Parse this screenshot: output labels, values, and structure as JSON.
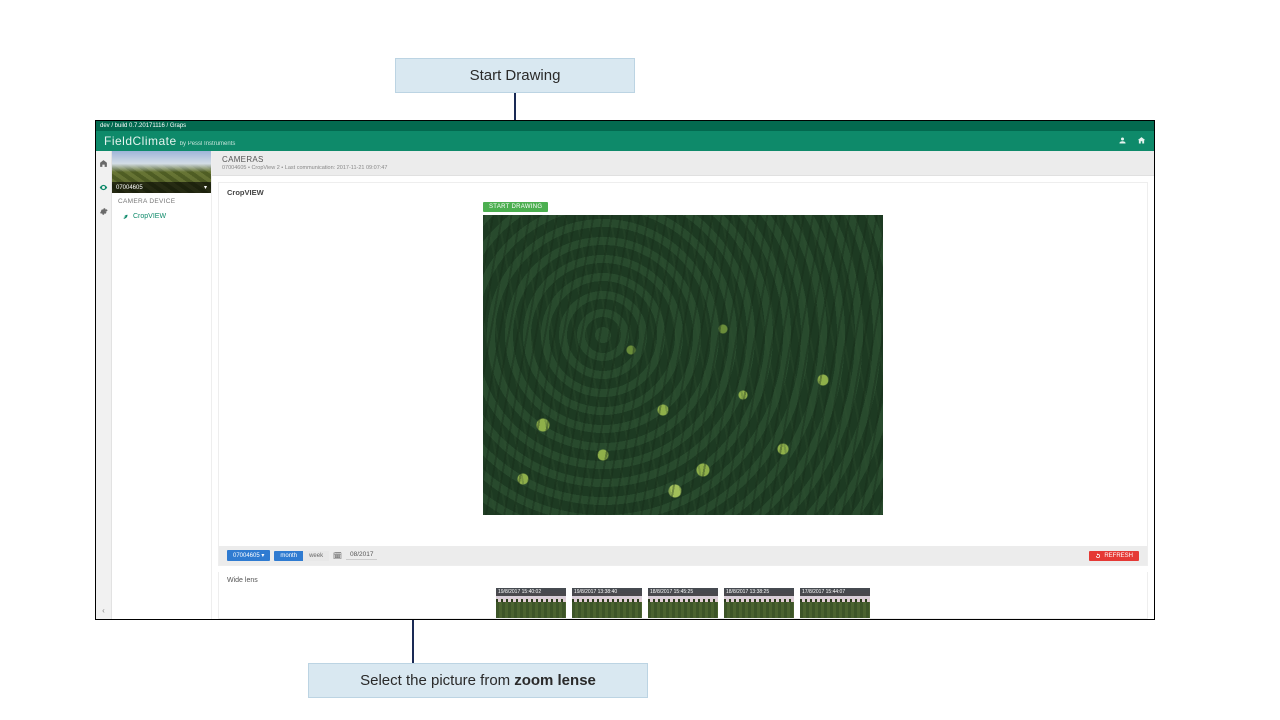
{
  "annotations": {
    "top": "Start Drawing",
    "bottom_prefix": "Select the picture from ",
    "bottom_bold": "zoom lense"
  },
  "build_bar": "dev / build 0.7.20171116 / Graps",
  "brand": {
    "main": "FieldClimate",
    "sub": "by Pessl Instruments"
  },
  "header_icons": {
    "user": "user-icon",
    "home": "home-icon"
  },
  "sidebar": {
    "hero_label": "07004605",
    "section": "CAMERA DEVICE",
    "item": "CropVIEW"
  },
  "page": {
    "title": "CAMERAS",
    "subtitle": "07004605 • CropView 2 • Last communication: 2017-11-21 09:07:47"
  },
  "card": {
    "title": "CropVIEW"
  },
  "buttons": {
    "start_drawing": "START DRAWING",
    "station": "07004605 ▾",
    "month": "month",
    "week": "week",
    "refresh": "REFRESH"
  },
  "toolbar": {
    "date": "08/2017"
  },
  "thumbs": {
    "title": "Wide lens",
    "items": [
      "19/8/2017 15:40:02",
      "19/8/2017 13:38:40",
      "18/8/2017 15:45:25",
      "18/8/2017 13:38:25",
      "17/8/2017 15:44:07"
    ]
  }
}
